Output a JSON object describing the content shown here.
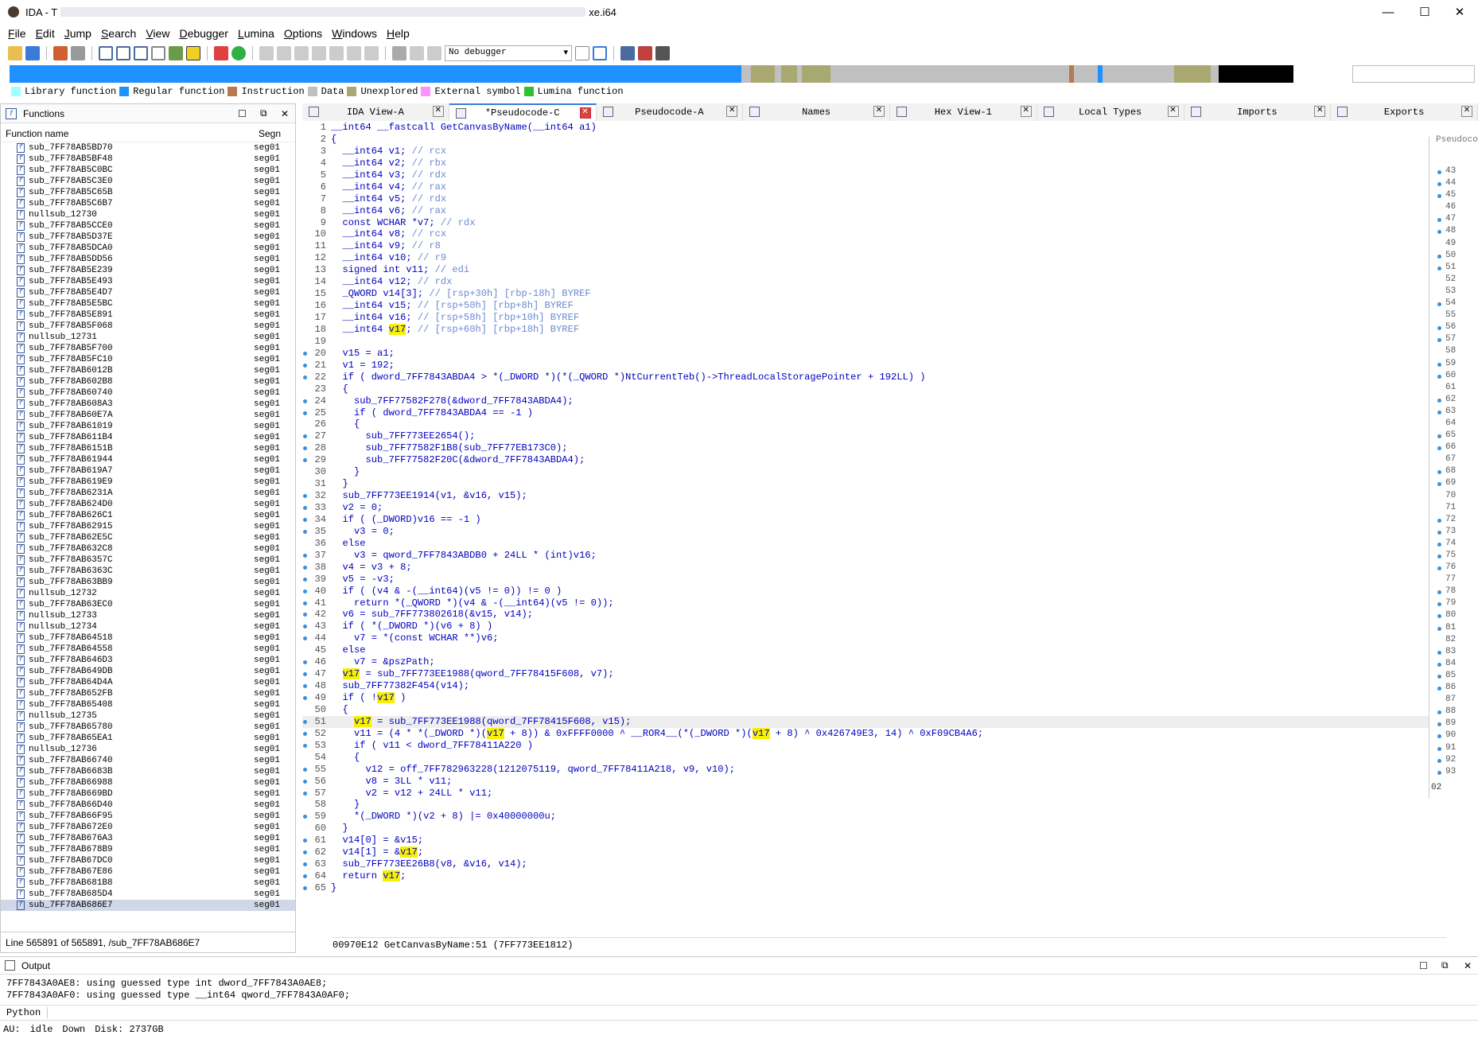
{
  "window": {
    "title": "IDA - T",
    "title_suffix": "xe.i64"
  },
  "menu": [
    "File",
    "Edit",
    "Jump",
    "Search",
    "View",
    "Debugger",
    "Lumina",
    "Options",
    "Windows",
    "Help"
  ],
  "toolbar": {
    "debugger_select": "No debugger"
  },
  "legend": [
    {
      "label": "Library function",
      "color": "#a0ffff"
    },
    {
      "label": "Regular function",
      "color": "#1e90ff"
    },
    {
      "label": "Instruction",
      "color": "#b87850"
    },
    {
      "label": "Data",
      "color": "#c0c0c0"
    },
    {
      "label": "Unexplored",
      "color": "#a8a870"
    },
    {
      "label": "External symbol",
      "color": "#ff90ff"
    },
    {
      "label": "Lumina function",
      "color": "#30c030"
    }
  ],
  "functions_panel": {
    "title": "Functions",
    "col_name": "Function name",
    "col_seg": "Segn",
    "rows": [
      "sub_7FF78AB5BD70",
      "sub_7FF78AB5BF48",
      "sub_7FF78AB5C0BC",
      "sub_7FF78AB5C3E0",
      "sub_7FF78AB5C65B",
      "sub_7FF78AB5C6B7",
      "nullsub_12730",
      "sub_7FF78AB5CCE0",
      "sub_7FF78AB5D37E",
      "sub_7FF78AB5DCA0",
      "sub_7FF78AB5DD56",
      "sub_7FF78AB5E239",
      "sub_7FF78AB5E493",
      "sub_7FF78AB5E4D7",
      "sub_7FF78AB5E5BC",
      "sub_7FF78AB5E891",
      "sub_7FF78AB5F068",
      "nullsub_12731",
      "sub_7FF78AB5F700",
      "sub_7FF78AB5FC10",
      "sub_7FF78AB6012B",
      "sub_7FF78AB602B8",
      "sub_7FF78AB60740",
      "sub_7FF78AB608A3",
      "sub_7FF78AB60E7A",
      "sub_7FF78AB61019",
      "sub_7FF78AB611B4",
      "sub_7FF78AB6151B",
      "sub_7FF78AB61944",
      "sub_7FF78AB619A7",
      "sub_7FF78AB619E9",
      "sub_7FF78AB6231A",
      "sub_7FF78AB624D0",
      "sub_7FF78AB626C1",
      "sub_7FF78AB62915",
      "sub_7FF78AB62E5C",
      "sub_7FF78AB632C8",
      "sub_7FF78AB6357C",
      "sub_7FF78AB6363C",
      "sub_7FF78AB63BB9",
      "nullsub_12732",
      "sub_7FF78AB63EC0",
      "nullsub_12733",
      "nullsub_12734",
      "sub_7FF78AB64518",
      "sub_7FF78AB64558",
      "sub_7FF78AB646D3",
      "sub_7FF78AB649DB",
      "sub_7FF78AB64D4A",
      "sub_7FF78AB652FB",
      "sub_7FF78AB65408",
      "nullsub_12735",
      "sub_7FF78AB65780",
      "sub_7FF78AB65EA1",
      "nullsub_12736",
      "sub_7FF78AB66740",
      "sub_7FF78AB6683B",
      "sub_7FF78AB66988",
      "sub_7FF78AB669BD",
      "sub_7FF78AB66D40",
      "sub_7FF78AB66F95",
      "sub_7FF78AB672E0",
      "sub_7FF78AB676A3",
      "sub_7FF78AB678B9",
      "sub_7FF78AB67DC0",
      "sub_7FF78AB67E86",
      "sub_7FF78AB681B8",
      "sub_7FF78AB685D4",
      "sub_7FF78AB686E7"
    ],
    "seg": "seg01",
    "status": "Line 565891 of 565891, /sub_7FF78AB686E7"
  },
  "tabs": [
    "IDA View-A",
    "Pseudocode-C",
    "Pseudocode-A",
    "Names",
    "Hex View-1",
    "Local Types",
    "Imports",
    "Exports"
  ],
  "floating_tab": "Pseudoco",
  "code_lines": [
    "__int64 __fastcall GetCanvasByName(__int64 a1)",
    "{",
    "  __int64 v1; // rcx",
    "  __int64 v2; // rbx",
    "  __int64 v3; // rdx",
    "  __int64 v4; // rax",
    "  __int64 v5; // rdx",
    "  __int64 v6; // rax",
    "  const WCHAR *v7; // rdx",
    "  __int64 v8; // rcx",
    "  __int64 v9; // r8",
    "  __int64 v10; // r9",
    "  signed int v11; // edi",
    "  __int64 v12; // rdx",
    "  _QWORD v14[3]; // [rsp+30h] [rbp-18h] BYREF",
    "  __int64 v15; // [rsp+50h] [rbp+8h] BYREF",
    "  __int64 v16; // [rsp+58h] [rbp+10h] BYREF",
    "  __int64 v17; // [rsp+60h] [rbp+18h] BYREF",
    "",
    "  v15 = a1;",
    "  v1 = 192;",
    "  if ( dword_7FF7843ABDA4 > *(_DWORD *)(*(_QWORD *)NtCurrentTeb()->ThreadLocalStoragePointer + 192LL) )",
    "  {",
    "    sub_7FF77582F278(&dword_7FF7843ABDA4);",
    "    if ( dword_7FF7843ABDA4 == -1 )",
    "    {",
    "      sub_7FF773EE2654();",
    "      sub_7FF77582F1B8(sub_7FF77EB173C0);",
    "      sub_7FF77582F20C(&dword_7FF7843ABDA4);",
    "    }",
    "  }",
    "  sub_7FF773EE1914(v1, &v16, v15);",
    "  v2 = 0;",
    "  if ( (_DWORD)v16 == -1 )",
    "    v3 = 0;",
    "  else",
    "    v3 = qword_7FF7843ABDB0 + 24LL * (int)v16;",
    "  v4 = v3 + 8;",
    "  v5 = -v3;",
    "  if ( (v4 & -(__int64)(v5 != 0)) != 0 )",
    "    return *(_QWORD *)(v4 & -(__int64)(v5 != 0));",
    "  v6 = sub_7FF773802618(&v15, v14);",
    "  if ( *(_DWORD *)(v6 + 8) )",
    "    v7 = *(const WCHAR **)v6;",
    "  else",
    "    v7 = &pszPath;",
    "  v17 = sub_7FF773EE1988(qword_7FF78415F608, v7);",
    "  sub_7FF77382F454(v14);",
    "  if ( !v17 )",
    "  {",
    "    v17 = sub_7FF773EE1988(qword_7FF78415F608, v15);",
    "    v11 = (4 * *(_DWORD *)(v17 + 8)) & 0xFFFF0000 ^ __ROR4__(*(_DWORD *)(v17 + 8) ^ 0x426749E3, 14) ^ 0xF09CB4A6;",
    "    if ( v11 < dword_7FF78411A220 )",
    "    {",
    "      v12 = off_7FF782963228(1212075119, qword_7FF78411A218, v9, v10);",
    "      v8 = 3LL * v11;",
    "      v2 = v12 + 24LL * v11;",
    "    }",
    "    *(_DWORD *)(v2 + 8) |= 0x40000000u;",
    "  }",
    "  v14[0] = &v15;",
    "  v14[1] = &v17;",
    "  sub_7FF773EE26B8(v8, &v16, v14);",
    "  return v17;",
    "}"
  ],
  "dotted_lines": [
    20,
    21,
    22,
    24,
    25,
    27,
    28,
    29,
    32,
    33,
    34,
    35,
    37,
    38,
    39,
    40,
    41,
    42,
    43,
    44,
    46,
    47,
    48,
    49,
    51,
    52,
    53,
    55,
    56,
    57,
    59,
    61,
    62,
    63,
    64,
    65
  ],
  "current_line": 51,
  "code_status": {
    "offset": "00970E12",
    "location": "GetCanvasByName:51",
    "address": "(7FF773EE1812)"
  },
  "side_lines": [
    "43",
    "44",
    "45",
    "46",
    "47",
    "48",
    "49",
    "50",
    "51",
    "52",
    "53",
    "54",
    "55",
    "56",
    "57",
    "58",
    "59",
    "60",
    "61",
    "62",
    "63",
    "64",
    "65",
    "66",
    "67",
    "68",
    "69",
    "70",
    "71",
    "72",
    "73",
    "74",
    "75",
    "76",
    "77",
    "78",
    "79",
    "80",
    "81",
    "82",
    "83",
    "84",
    "85",
    "86",
    "87",
    "88",
    "89",
    "90",
    "91",
    "92",
    "93"
  ],
  "side_dotted": [
    "43",
    "44",
    "45",
    "47",
    "48",
    "50",
    "51",
    "54",
    "56",
    "57",
    "59",
    "60",
    "62",
    "63",
    "65",
    "66",
    "68",
    "69",
    "72",
    "73",
    "74",
    "75",
    "76",
    "78",
    "79",
    "80",
    "81",
    "83",
    "84",
    "85",
    "86",
    "88",
    "89",
    "90",
    "91",
    "92",
    "93"
  ],
  "side_bottom": "02",
  "output": {
    "title": "Output",
    "lines": [
      "7FF7843A0AE8: using guessed type int dword_7FF7843A0AE8;",
      "7FF7843A0AF0: using guessed type __int64 qword_7FF7843A0AF0;"
    ],
    "lang": "Python",
    "au": "AU:",
    "state": "idle",
    "dir": "Down",
    "disk": "Disk: 2737GB"
  }
}
